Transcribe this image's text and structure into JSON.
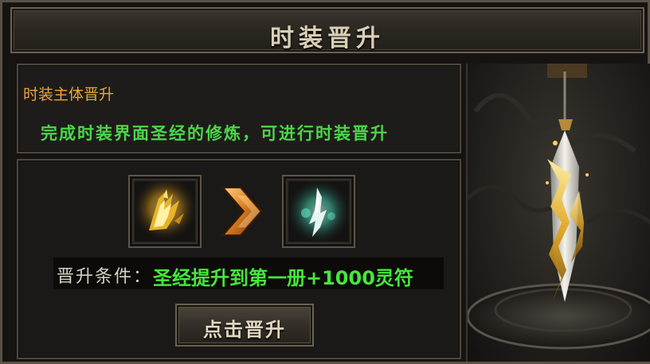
{
  "window": {
    "title": "时装晋升"
  },
  "info": {
    "subtitle": "时装主体晋升",
    "description": "完成时装界面圣经的修炼，可进行时装晋升"
  },
  "upgrade": {
    "from_item_icon": "golden-flame-blade-icon",
    "to_item_icon": "cyan-spirit-blade-icon",
    "arrow_icon": "double-chevron-right-icon",
    "condition_label": "晋升条件：",
    "condition_value": "圣经提升到第一册+1000灵符",
    "button_label": "点击晋升"
  },
  "preview": {
    "item_icon": "golden-sword-model-icon"
  },
  "colors": {
    "subtitle": "#e8a63a",
    "description": "#4cd64a",
    "condition_value": "#47e63a",
    "frame_border": "#5a5246"
  }
}
